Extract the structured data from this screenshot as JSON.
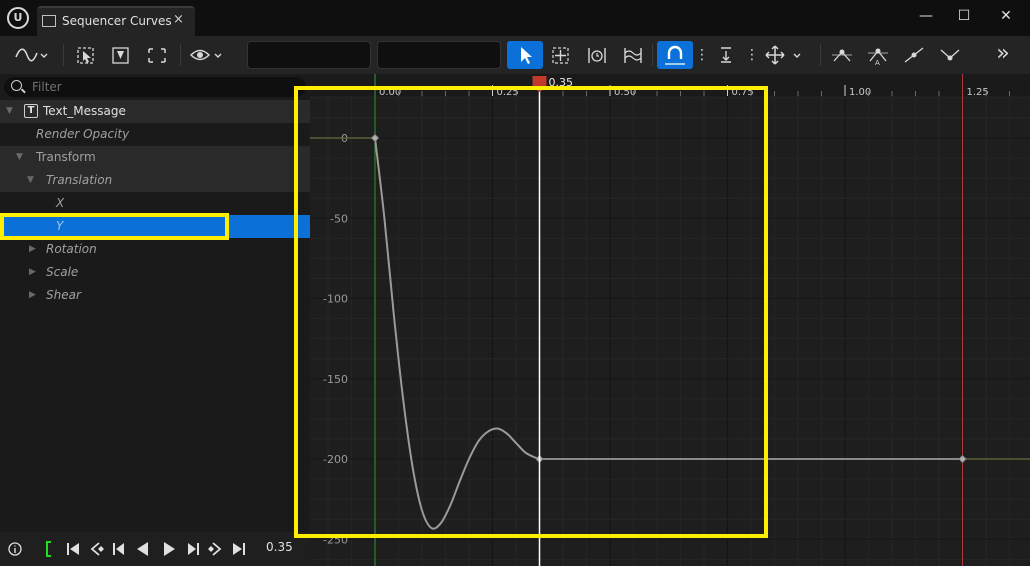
{
  "window": {
    "tab_title": "Sequencer Curves",
    "tab_close": "×",
    "minimize": "—",
    "maximize": "☐",
    "close": "✕"
  },
  "toolbar": {
    "overflow": "»"
  },
  "tree": {
    "filter_placeholder": "Filter",
    "items": [
      {
        "label": "Text_Message",
        "depth": 0,
        "expanded": true,
        "selected": false
      },
      {
        "label": "Render Opacity",
        "depth": 1,
        "selected": false
      },
      {
        "label": "Transform",
        "depth": 1,
        "expanded": true,
        "selected": false
      },
      {
        "label": "Translation",
        "depth": 2,
        "expanded": true,
        "selected": false
      },
      {
        "label": "X",
        "depth": 3,
        "selected": false
      },
      {
        "label": "Y",
        "depth": 3,
        "selected": true
      },
      {
        "label": "Rotation",
        "depth": 2,
        "expanded": false,
        "selected": false
      },
      {
        "label": "Scale",
        "depth": 2,
        "expanded": false,
        "selected": false
      },
      {
        "label": "Shear",
        "depth": 2,
        "expanded": false,
        "selected": false
      }
    ]
  },
  "playback": {
    "current_time": "0.35"
  },
  "timeline": {
    "playhead_label": "0.35",
    "time_ticks": [
      "0.00",
      "0.25",
      "0.50",
      "0.75",
      "1.00",
      "1.25"
    ],
    "value_ticks": [
      "0",
      "-50",
      "-100",
      "-150",
      "-200",
      "-250"
    ]
  },
  "chart_data": {
    "type": "line",
    "title": "",
    "xlabel": "",
    "ylabel": "",
    "xlim": [
      -0.13,
      1.4
    ],
    "ylim": [
      -250,
      20
    ],
    "playhead_time": 0.35,
    "start_time": 0.0,
    "end_time": 1.25,
    "series": [
      {
        "keys": [
          {
            "x": 0.0,
            "y": 0
          },
          {
            "x": 0.35,
            "y": -200
          },
          {
            "x": 1.25,
            "y": -200
          }
        ],
        "x": [
          0.0,
          0.02,
          0.04,
          0.06,
          0.08,
          0.1,
          0.12,
          0.14,
          0.16,
          0.18,
          0.2,
          0.22,
          0.24,
          0.26,
          0.28,
          0.3,
          0.32,
          0.34,
          0.35
        ],
        "y": [
          0,
          -50,
          -110,
          -163,
          -205,
          -232,
          -243,
          -240,
          -229,
          -214,
          -200,
          -189,
          -183,
          -181,
          -184,
          -190,
          -196,
          -199,
          -200
        ]
      }
    ],
    "colors": {
      "curve": "#9a9a9a",
      "playhead": "#ffffff",
      "playhead_marker": "#c0392b",
      "start_marker": "#2e9e2e",
      "end_marker": "#b03a3a",
      "highlight": "#ffee00",
      "selection": "#0b71d8"
    }
  }
}
